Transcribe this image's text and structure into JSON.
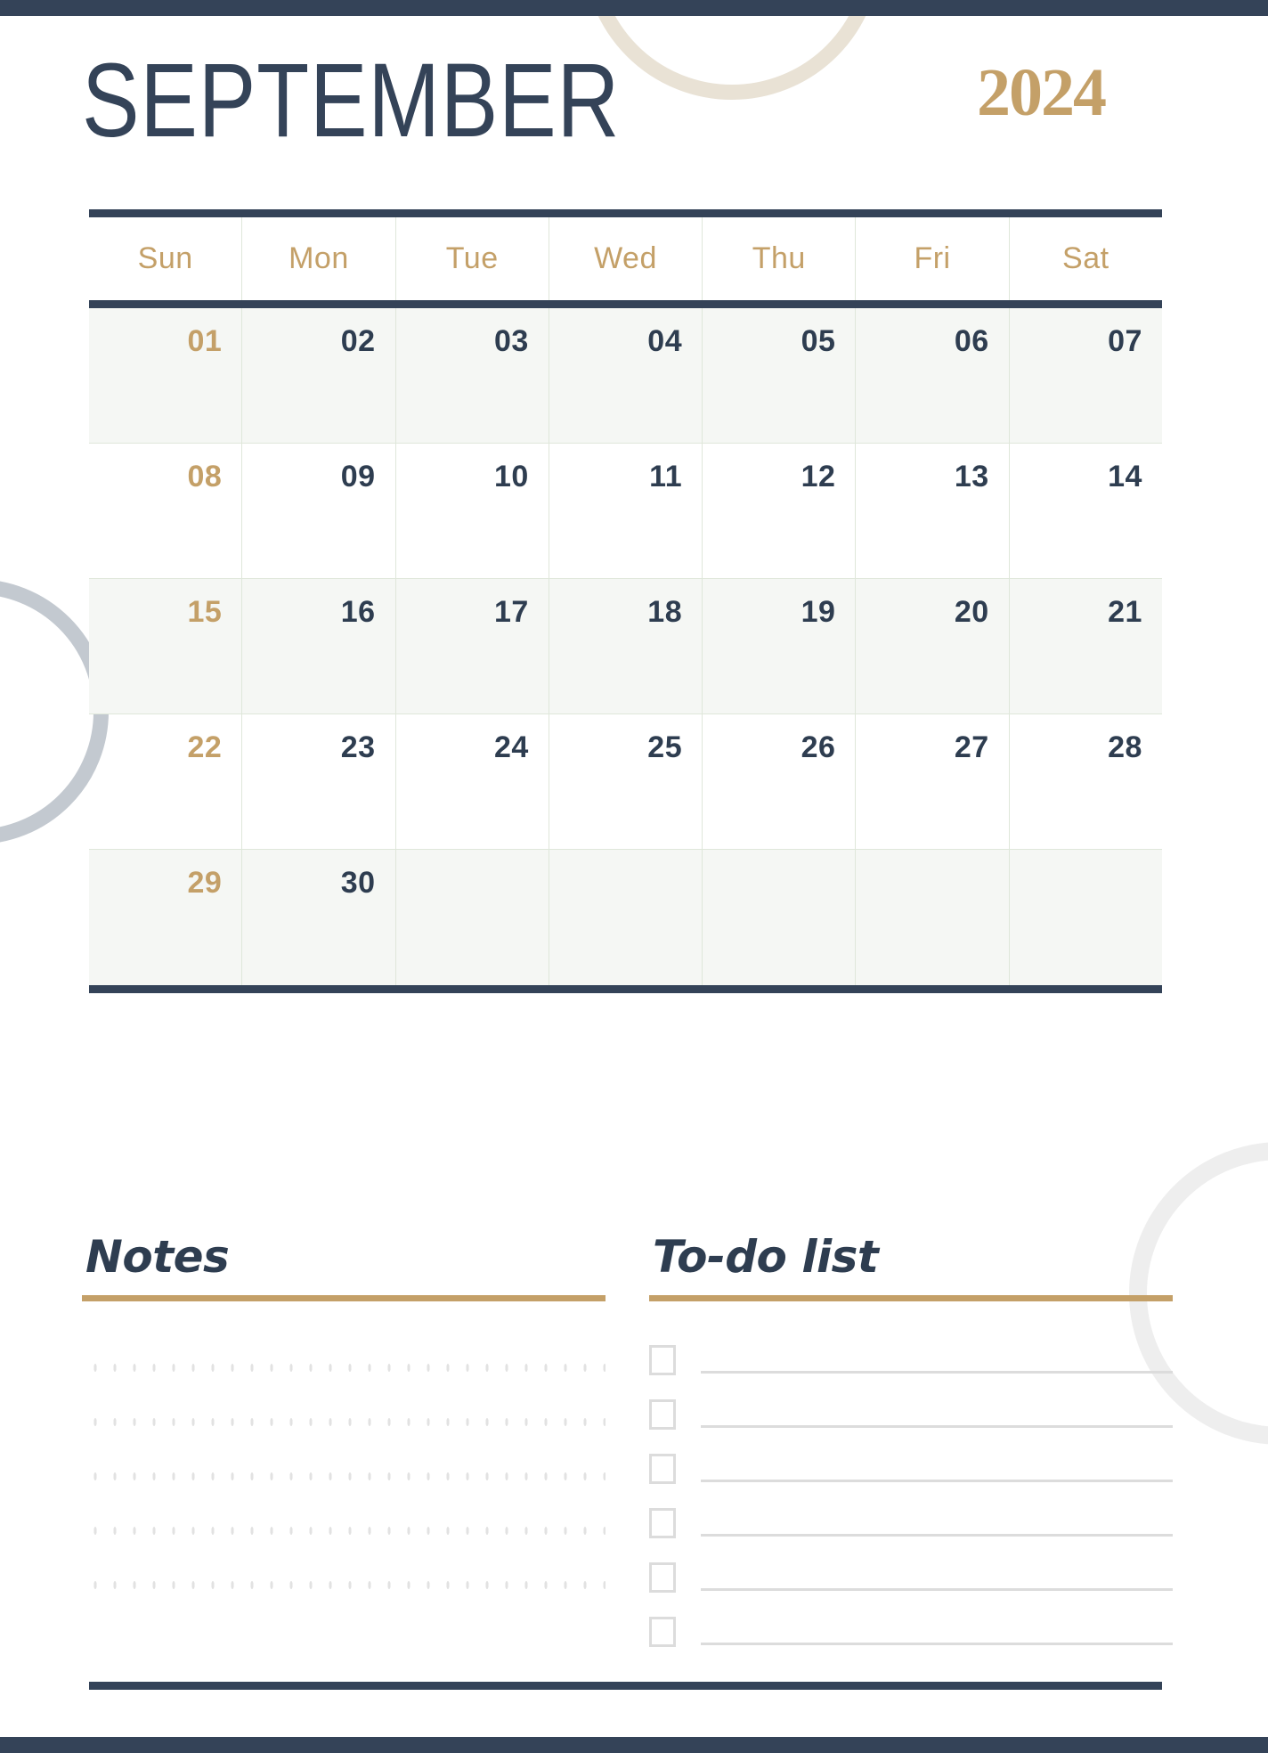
{
  "page": {
    "month_title": "SEPTEMBER",
    "year": "2024"
  },
  "colors": {
    "navy": "#344358",
    "gold": "#c4a068",
    "shaded_row": "#f5f7f4",
    "gridline": "#dfe7da",
    "deco_beige": "#e9e2d5",
    "deco_blue_gray": "#c3c9d0",
    "deco_light_gray": "#eeeeee",
    "dot_gray": "#e2e2e2",
    "checkbox_gray": "#dcdcdc"
  },
  "calendar": {
    "weekdays": [
      "Sun",
      "Mon",
      "Tue",
      "Wed",
      "Thu",
      "Fri",
      "Sat"
    ],
    "weeks": [
      [
        "01",
        "02",
        "03",
        "04",
        "05",
        "06",
        "07"
      ],
      [
        "08",
        "09",
        "10",
        "11",
        "12",
        "13",
        "14"
      ],
      [
        "15",
        "16",
        "17",
        "18",
        "19",
        "20",
        "21"
      ],
      [
        "22",
        "23",
        "24",
        "25",
        "26",
        "27",
        "28"
      ],
      [
        "29",
        "30",
        "",
        "",
        "",
        "",
        ""
      ]
    ]
  },
  "notes": {
    "title": "Notes"
  },
  "todo": {
    "title": "To-do list",
    "row_count": 6
  }
}
